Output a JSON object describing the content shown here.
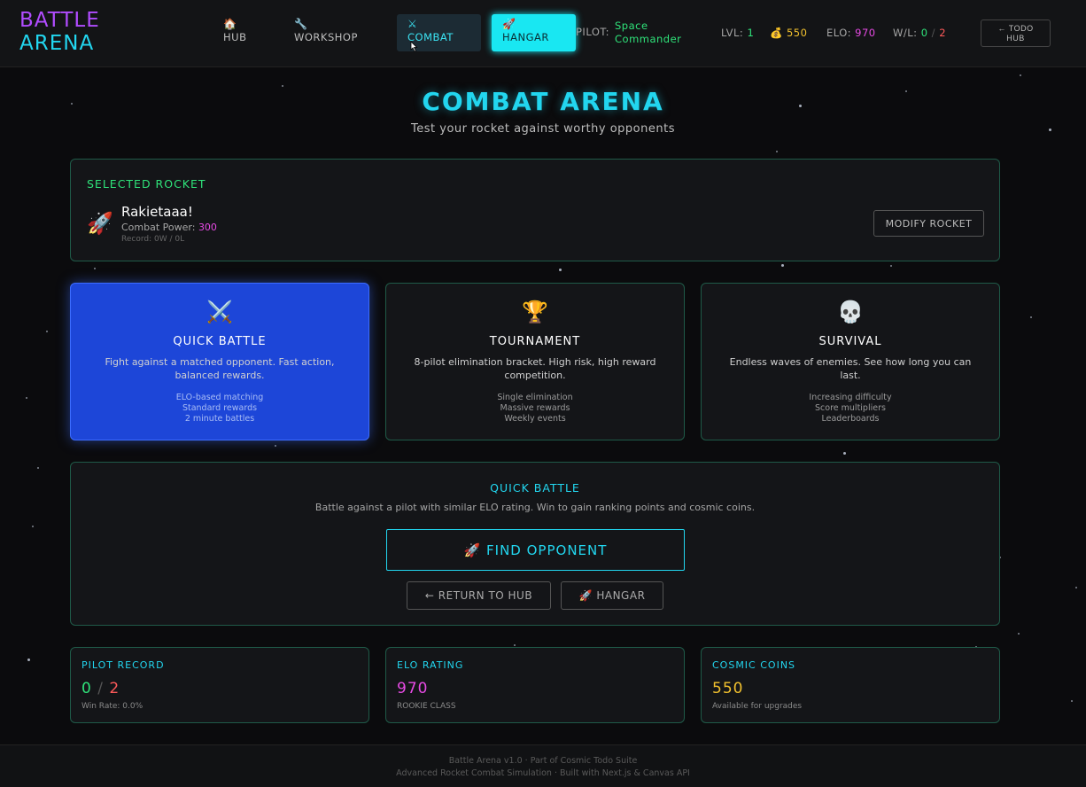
{
  "header": {
    "logo_line1": "BATTLE",
    "logo_line2": "ARENA",
    "nav": [
      {
        "icon": "🏠",
        "label": "HUB"
      },
      {
        "icon": "🔧",
        "label": "WORKSHOP"
      },
      {
        "icon": "⚔",
        "label": "COMBAT"
      },
      {
        "icon": "🚀",
        "label": "HANGAR"
      }
    ],
    "pilot_label": "PILOT:",
    "pilot_name": "Space Commander",
    "level_label": "LVL:",
    "level_value": "1",
    "coins_icon": "💰",
    "coins_value": "550",
    "elo_label": "ELO:",
    "elo_value": "970",
    "wl_label": "W/L:",
    "wins": "0",
    "wl_sep": "/",
    "losses": "2",
    "todo_button": "← TODO HUB"
  },
  "page": {
    "title": "COMBAT ARENA",
    "subtitle": "Test your rocket against worthy opponents"
  },
  "selected_rocket": {
    "heading": "SELECTED ROCKET",
    "icon": "🚀",
    "name": "Rakietaaa!",
    "power_label": "Combat Power:",
    "power_value": "300",
    "record": "Record: 0W / 0L",
    "modify_button": "MODIFY ROCKET"
  },
  "modes": [
    {
      "icon": "⚔️",
      "title": "QUICK BATTLE",
      "description": "Fight against a matched opponent. Fast action, balanced rewards.",
      "features": [
        "ELO-based matching",
        "Standard rewards",
        "2 minute battles"
      ]
    },
    {
      "icon": "🏆",
      "title": "TOURNAMENT",
      "description": "8-pilot elimination bracket. High risk, high reward competition.",
      "features": [
        "Single elimination",
        "Massive rewards",
        "Weekly events"
      ]
    },
    {
      "icon": "💀",
      "title": "SURVIVAL",
      "description": "Endless waves of enemies. See how long you can last.",
      "features": [
        "Increasing difficulty",
        "Score multipliers",
        "Leaderboards"
      ]
    }
  ],
  "quick_battle": {
    "title": "QUICK BATTLE",
    "description": "Battle against a pilot with similar ELO rating. Win to gain ranking points and cosmic coins.",
    "find_button": "🚀 FIND OPPONENT",
    "return_button": "← RETURN TO HUB",
    "hangar_button": "🚀 HANGAR"
  },
  "stats": {
    "record_title": "PILOT RECORD",
    "record_wins": "0",
    "record_sep": "/",
    "record_losses": "2",
    "record_sub": "Win Rate: 0.0%",
    "elo_title": "ELO RATING",
    "elo_value": "970",
    "elo_sub": "ROOKIE CLASS",
    "coins_title": "COSMIC COINS",
    "coins_value": "550",
    "coins_sub": "Available for upgrades"
  },
  "footer": {
    "line1": "Battle Arena v1.0 · Part of Cosmic Todo Suite",
    "line2": "Advanced Rocket Combat Simulation · Built with Next.js & Canvas API"
  }
}
